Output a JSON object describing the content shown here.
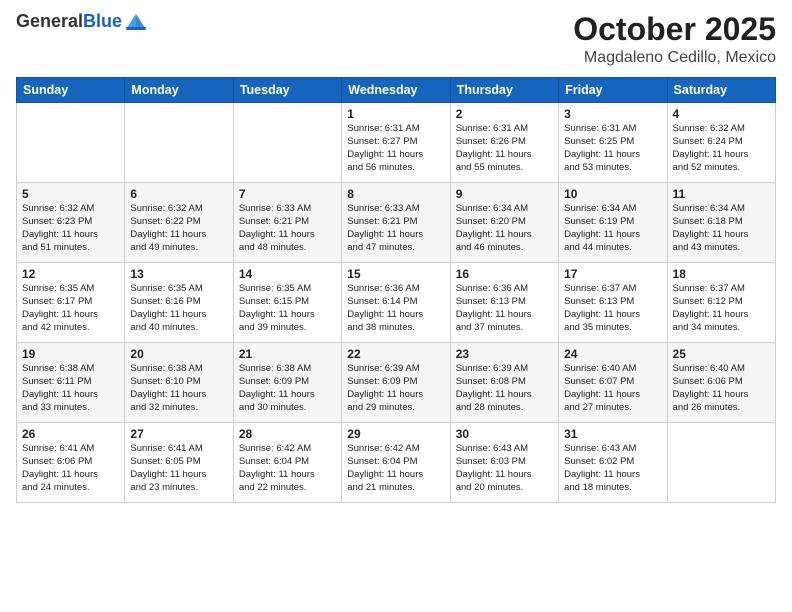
{
  "header": {
    "logo_general": "General",
    "logo_blue": "Blue",
    "month": "October 2025",
    "location": "Magdaleno Cedillo, Mexico"
  },
  "days_of_week": [
    "Sunday",
    "Monday",
    "Tuesday",
    "Wednesday",
    "Thursday",
    "Friday",
    "Saturday"
  ],
  "weeks": [
    [
      {
        "day": "",
        "info": ""
      },
      {
        "day": "",
        "info": ""
      },
      {
        "day": "",
        "info": ""
      },
      {
        "day": "1",
        "info": "Sunrise: 6:31 AM\nSunset: 6:27 PM\nDaylight: 11 hours\nand 56 minutes."
      },
      {
        "day": "2",
        "info": "Sunrise: 6:31 AM\nSunset: 6:26 PM\nDaylight: 11 hours\nand 55 minutes."
      },
      {
        "day": "3",
        "info": "Sunrise: 6:31 AM\nSunset: 6:25 PM\nDaylight: 11 hours\nand 53 minutes."
      },
      {
        "day": "4",
        "info": "Sunrise: 6:32 AM\nSunset: 6:24 PM\nDaylight: 11 hours\nand 52 minutes."
      }
    ],
    [
      {
        "day": "5",
        "info": "Sunrise: 6:32 AM\nSunset: 6:23 PM\nDaylight: 11 hours\nand 51 minutes."
      },
      {
        "day": "6",
        "info": "Sunrise: 6:32 AM\nSunset: 6:22 PM\nDaylight: 11 hours\nand 49 minutes."
      },
      {
        "day": "7",
        "info": "Sunrise: 6:33 AM\nSunset: 6:21 PM\nDaylight: 11 hours\nand 48 minutes."
      },
      {
        "day": "8",
        "info": "Sunrise: 6:33 AM\nSunset: 6:21 PM\nDaylight: 11 hours\nand 47 minutes."
      },
      {
        "day": "9",
        "info": "Sunrise: 6:34 AM\nSunset: 6:20 PM\nDaylight: 11 hours\nand 46 minutes."
      },
      {
        "day": "10",
        "info": "Sunrise: 6:34 AM\nSunset: 6:19 PM\nDaylight: 11 hours\nand 44 minutes."
      },
      {
        "day": "11",
        "info": "Sunrise: 6:34 AM\nSunset: 6:18 PM\nDaylight: 11 hours\nand 43 minutes."
      }
    ],
    [
      {
        "day": "12",
        "info": "Sunrise: 6:35 AM\nSunset: 6:17 PM\nDaylight: 11 hours\nand 42 minutes."
      },
      {
        "day": "13",
        "info": "Sunrise: 6:35 AM\nSunset: 6:16 PM\nDaylight: 11 hours\nand 40 minutes."
      },
      {
        "day": "14",
        "info": "Sunrise: 6:35 AM\nSunset: 6:15 PM\nDaylight: 11 hours\nand 39 minutes."
      },
      {
        "day": "15",
        "info": "Sunrise: 6:36 AM\nSunset: 6:14 PM\nDaylight: 11 hours\nand 38 minutes."
      },
      {
        "day": "16",
        "info": "Sunrise: 6:36 AM\nSunset: 6:13 PM\nDaylight: 11 hours\nand 37 minutes."
      },
      {
        "day": "17",
        "info": "Sunrise: 6:37 AM\nSunset: 6:13 PM\nDaylight: 11 hours\nand 35 minutes."
      },
      {
        "day": "18",
        "info": "Sunrise: 6:37 AM\nSunset: 6:12 PM\nDaylight: 11 hours\nand 34 minutes."
      }
    ],
    [
      {
        "day": "19",
        "info": "Sunrise: 6:38 AM\nSunset: 6:11 PM\nDaylight: 11 hours\nand 33 minutes."
      },
      {
        "day": "20",
        "info": "Sunrise: 6:38 AM\nSunset: 6:10 PM\nDaylight: 11 hours\nand 32 minutes."
      },
      {
        "day": "21",
        "info": "Sunrise: 6:38 AM\nSunset: 6:09 PM\nDaylight: 11 hours\nand 30 minutes."
      },
      {
        "day": "22",
        "info": "Sunrise: 6:39 AM\nSunset: 6:09 PM\nDaylight: 11 hours\nand 29 minutes."
      },
      {
        "day": "23",
        "info": "Sunrise: 6:39 AM\nSunset: 6:08 PM\nDaylight: 11 hours\nand 28 minutes."
      },
      {
        "day": "24",
        "info": "Sunrise: 6:40 AM\nSunset: 6:07 PM\nDaylight: 11 hours\nand 27 minutes."
      },
      {
        "day": "25",
        "info": "Sunrise: 6:40 AM\nSunset: 6:06 PM\nDaylight: 11 hours\nand 26 minutes."
      }
    ],
    [
      {
        "day": "26",
        "info": "Sunrise: 6:41 AM\nSunset: 6:06 PM\nDaylight: 11 hours\nand 24 minutes."
      },
      {
        "day": "27",
        "info": "Sunrise: 6:41 AM\nSunset: 6:05 PM\nDaylight: 11 hours\nand 23 minutes."
      },
      {
        "day": "28",
        "info": "Sunrise: 6:42 AM\nSunset: 6:04 PM\nDaylight: 11 hours\nand 22 minutes."
      },
      {
        "day": "29",
        "info": "Sunrise: 6:42 AM\nSunset: 6:04 PM\nDaylight: 11 hours\nand 21 minutes."
      },
      {
        "day": "30",
        "info": "Sunrise: 6:43 AM\nSunset: 6:03 PM\nDaylight: 11 hours\nand 20 minutes."
      },
      {
        "day": "31",
        "info": "Sunrise: 6:43 AM\nSunset: 6:02 PM\nDaylight: 11 hours\nand 18 minutes."
      },
      {
        "day": "",
        "info": ""
      }
    ]
  ]
}
